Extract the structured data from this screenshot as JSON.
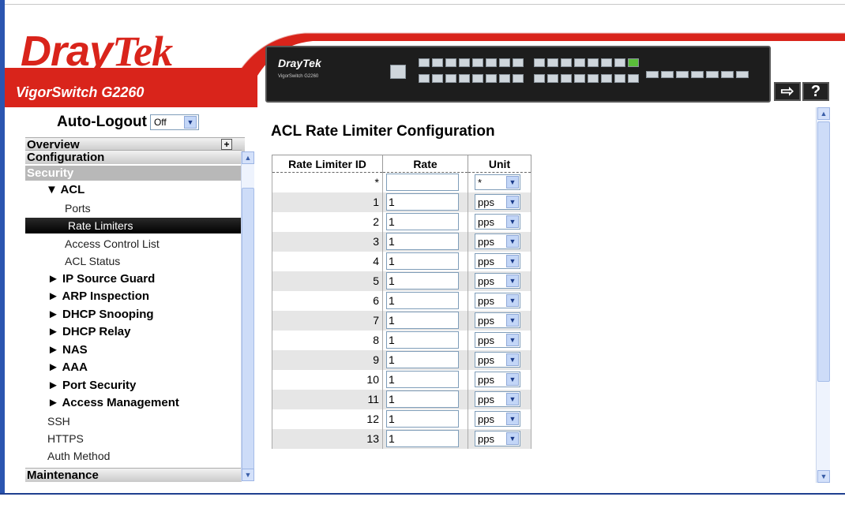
{
  "header": {
    "logo_dray": "Dray",
    "logo_tek": "Tek",
    "model": "VigorSwitch G2260",
    "device_brand": "DrayTek",
    "device_model": "VigorSwitch G2260",
    "logout_icon": "logout-arrow-icon",
    "help_label": "?"
  },
  "colors": {
    "brand_red": "#d9241b",
    "accent_blue": "#2b55b0",
    "selected_bg": "#000000",
    "security_header": "#b8b8b8"
  },
  "sidebar": {
    "autologout_label": "Auto-Logout",
    "autologout_value": "Off",
    "overview": "Overview",
    "configuration": "Configuration",
    "security": "Security",
    "acl": "▼ ACL",
    "ports": "Ports",
    "rate_limiters": "Rate Limiters",
    "access_control_list": "Access Control List",
    "acl_status": "ACL Status",
    "ip_source_guard": "► IP Source Guard",
    "arp_inspection": "► ARP Inspection",
    "dhcp_snooping": "► DHCP Snooping",
    "dhcp_relay": "► DHCP Relay",
    "nas": "► NAS",
    "aaa": "► AAA",
    "port_security": "► Port Security",
    "access_management": "► Access Management",
    "ssh": "SSH",
    "https": "HTTPS",
    "auth_method": "Auth Method",
    "maintenance": "Maintenance"
  },
  "main": {
    "title": "ACL Rate Limiter Configuration",
    "columns": [
      "Rate Limiter ID",
      "Rate",
      "Unit"
    ],
    "wildcard_row": {
      "id": "*",
      "rate": "",
      "unit": "*"
    },
    "rows": [
      {
        "id": "1",
        "rate": "1",
        "unit": "pps"
      },
      {
        "id": "2",
        "rate": "1",
        "unit": "pps"
      },
      {
        "id": "3",
        "rate": "1",
        "unit": "pps"
      },
      {
        "id": "4",
        "rate": "1",
        "unit": "pps"
      },
      {
        "id": "5",
        "rate": "1",
        "unit": "pps"
      },
      {
        "id": "6",
        "rate": "1",
        "unit": "pps"
      },
      {
        "id": "7",
        "rate": "1",
        "unit": "pps"
      },
      {
        "id": "8",
        "rate": "1",
        "unit": "pps"
      },
      {
        "id": "9",
        "rate": "1",
        "unit": "pps"
      },
      {
        "id": "10",
        "rate": "1",
        "unit": "pps"
      },
      {
        "id": "11",
        "rate": "1",
        "unit": "pps"
      },
      {
        "id": "12",
        "rate": "1",
        "unit": "pps"
      },
      {
        "id": "13",
        "rate": "1",
        "unit": "pps"
      }
    ]
  }
}
